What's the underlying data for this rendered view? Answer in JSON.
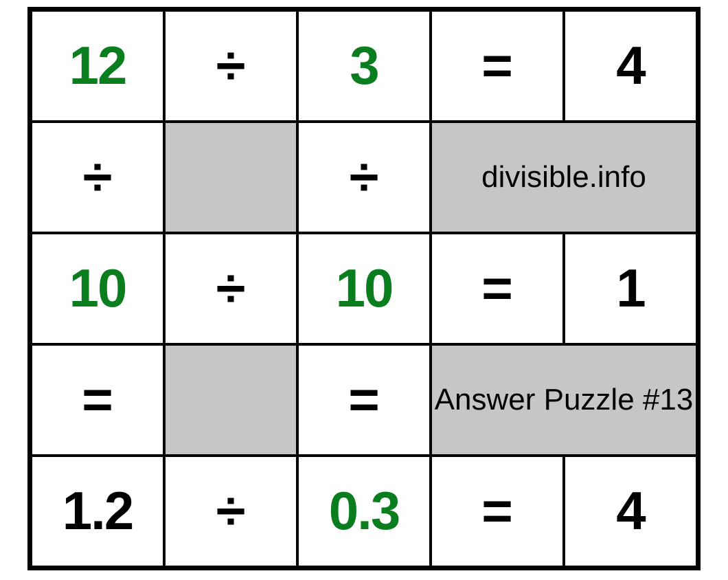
{
  "colors": {
    "green": "#0a7d1e",
    "grey": "#c6c6c6"
  },
  "symbols": {
    "divide": "÷",
    "equals": "="
  },
  "rows": {
    "r1": {
      "a": "12",
      "op1": "÷",
      "b": "3",
      "op2": "=",
      "c": "4"
    },
    "r2": {
      "a": "÷",
      "b": "÷",
      "label": "divisible.info"
    },
    "r3": {
      "a": "10",
      "op1": "÷",
      "b": "10",
      "op2": "=",
      "c": "1"
    },
    "r4": {
      "a": "=",
      "b": "=",
      "label": "Answer Puzzle #13"
    },
    "r5": {
      "a": "1.2",
      "op1": "÷",
      "b": "0.3",
      "op2": "=",
      "c": "4"
    }
  }
}
